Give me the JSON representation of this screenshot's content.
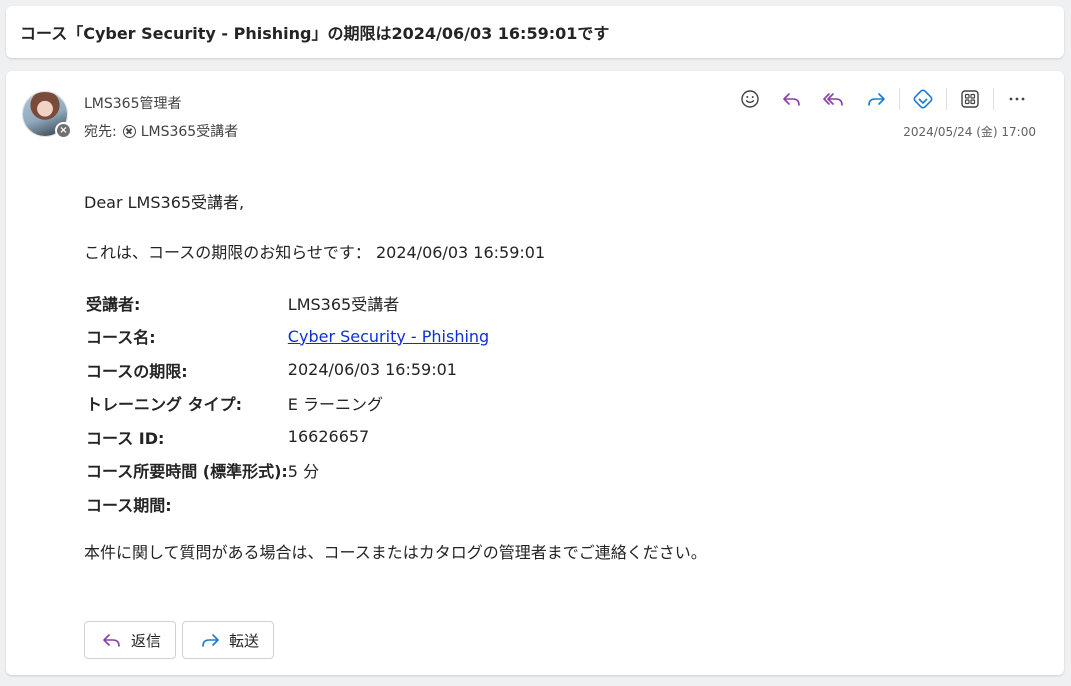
{
  "subject": "コース「Cyber Security - Phishing」の期限は2024/06/03 16:59:01です",
  "message": {
    "sender": "LMS365管理者",
    "to_label": "宛先:",
    "recipient": "LMS365受講者",
    "date": "2024/05/24 (金) 17:00",
    "greeting": "Dear LMS365受講者,",
    "notice": "これは、コースの期限のお知らせです： 2024/06/03 16:59:01",
    "fields": [
      {
        "label": "受講者:",
        "value": "LMS365受講者"
      },
      {
        "label": "コース名:",
        "value": "Cyber Security - Phishing"
      },
      {
        "label": "コースの期限:",
        "value": "2024/06/03 16:59:01"
      },
      {
        "label": "トレーニング タイプ:",
        "value": "E ラーニング"
      },
      {
        "label": "コース ID:",
        "value": "16626657"
      },
      {
        "label": "コース所要時間 (標準形式):",
        "value": "5 分"
      },
      {
        "label": "コース期間:",
        "value": ""
      }
    ],
    "closing": "本件に関して質問がある場合は、コースまたはカタログの管理者までご連絡ください。"
  },
  "toolbar": {
    "icons": [
      "smiley-icon",
      "reply-icon",
      "reply-all-icon",
      "forward-icon",
      "viva-icon",
      "apps-icon",
      "more-icon"
    ]
  },
  "actions": {
    "reply_label": "返信",
    "forward_label": "転送"
  },
  "colors": {
    "reply_purple": "#8a3fa8",
    "forward_blue": "#1d7ad4",
    "link_blue": "#0f2fd6"
  }
}
